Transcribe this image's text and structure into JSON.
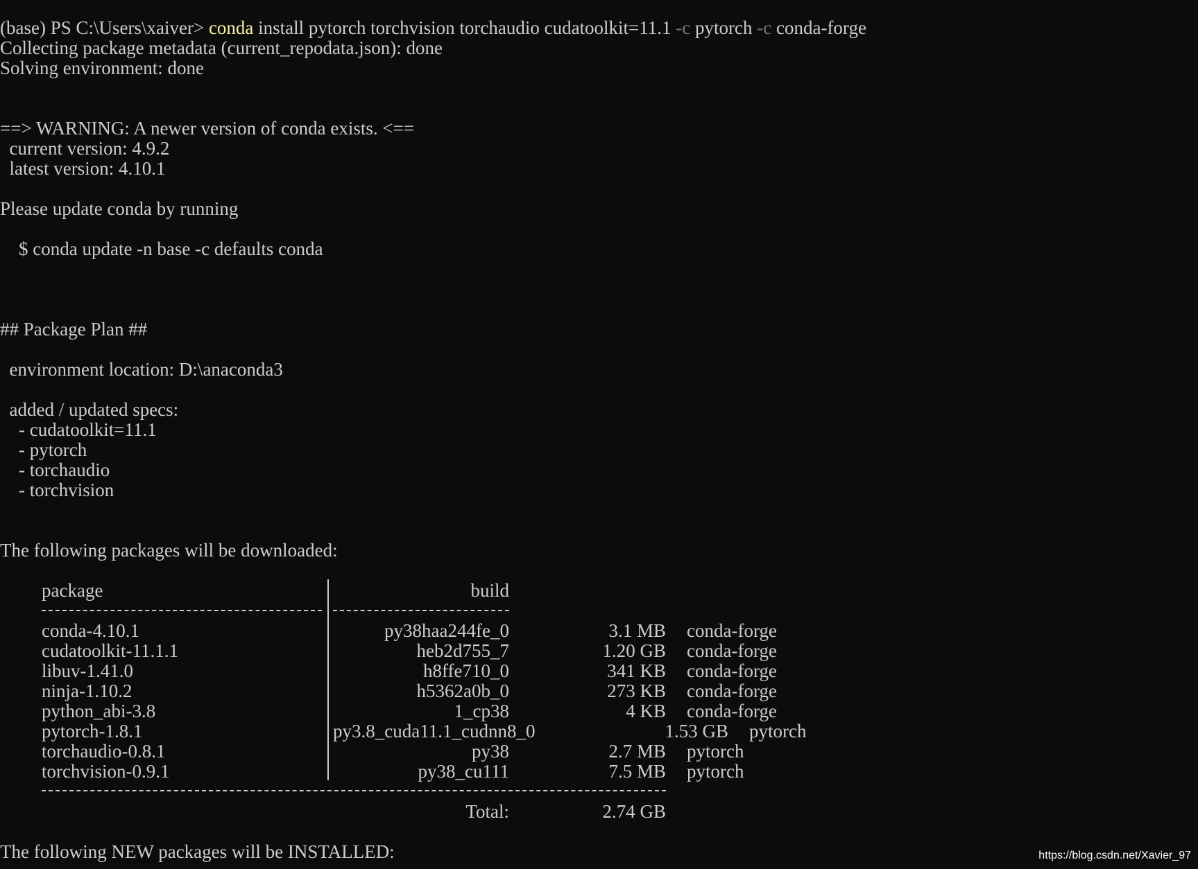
{
  "prompt": "(base) PS C:\\Users\\xaiver> ",
  "command": {
    "exe": "conda",
    "part1": " install pytorch torchvision torchaudio cudatoolkit=11.1 ",
    "flag1": "-c",
    "part2": " pytorch ",
    "flag2": "-c",
    "part3": " conda-forge"
  },
  "lines": {
    "collecting": "Collecting package metadata (current_repodata.json): done",
    "solving": "Solving environment: done",
    "warning": "==> WARNING: A newer version of conda exists. <==",
    "current_version": "  current version: 4.9.2",
    "latest_version": "  latest version: 4.10.1",
    "please_update": "Please update conda by running",
    "update_cmd": "    $ conda update -n base -c defaults conda",
    "plan_header": "## Package Plan ##",
    "env_location": "  environment location: D:\\anaconda3",
    "specs_header": "  added / updated specs:",
    "downloaded_header": "The following packages will be downloaded:",
    "installed_header": "The following NEW packages will be INSTALLED:"
  },
  "specs": [
    "    - cudatoolkit=11.1",
    "    - pytorch",
    "    - torchaudio",
    "    - torchvision"
  ],
  "table": {
    "col_package": "package",
    "col_build": "build",
    "rows": [
      {
        "package": "conda-4.10.1",
        "build": "py38haa244fe_0",
        "size": "3.1 MB",
        "channel": "conda-forge"
      },
      {
        "package": "cudatoolkit-11.1.1",
        "build": "heb2d755_7",
        "size": "1.20 GB",
        "channel": "conda-forge"
      },
      {
        "package": "libuv-1.41.0",
        "build": "h8ffe710_0",
        "size": "341 KB",
        "channel": "conda-forge"
      },
      {
        "package": "ninja-1.10.2",
        "build": "h5362a0b_0",
        "size": "273 KB",
        "channel": "conda-forge"
      },
      {
        "package": "python_abi-3.8",
        "build": "1_cp38",
        "size": "4 KB",
        "channel": "conda-forge"
      },
      {
        "package": "pytorch-1.8.1",
        "build": "py3.8_cuda11.1_cudnn8_0",
        "size": "1.53 GB",
        "channel": "pytorch"
      },
      {
        "package": "torchaudio-0.8.1",
        "build": "py38",
        "size": "2.7 MB",
        "channel": "pytorch"
      },
      {
        "package": "torchvision-0.9.1",
        "build": "py38_cu111",
        "size": "7.5 MB",
        "channel": "pytorch"
      }
    ],
    "total_label": "Total:",
    "total_value": "2.74 GB"
  },
  "watermark": "https://blog.csdn.net/Xavier_97"
}
